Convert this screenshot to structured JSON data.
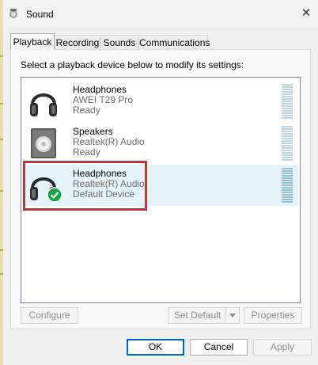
{
  "window": {
    "title": "Sound",
    "close_icon": "close-icon"
  },
  "tabs": [
    {
      "label": "Playback",
      "active": true
    },
    {
      "label": "Recording",
      "active": false
    },
    {
      "label": "Sounds",
      "active": false
    },
    {
      "label": "Communications",
      "active": false
    }
  ],
  "playback": {
    "instruction": "Select a playback device below to modify its settings:",
    "devices": [
      {
        "name": "Headphones",
        "description": "AWEI T29 Pro",
        "status": "Ready",
        "icon": "headphones-icon",
        "selected": false
      },
      {
        "name": "Speakers",
        "description": "Realtek(R) Audio",
        "status": "Ready",
        "icon": "speaker-icon",
        "selected": false
      },
      {
        "name": "Headphones",
        "description": "Realtek(R) Audio",
        "status": "Default Device",
        "icon": "headphones-icon",
        "selected": true,
        "default_badge_icon": "green-check-icon"
      }
    ],
    "buttons": {
      "configure": "Configure",
      "set_default": "Set Default",
      "properties": "Properties"
    }
  },
  "footer": {
    "ok": "OK",
    "cancel": "Cancel",
    "apply": "Apply"
  },
  "colors": {
    "highlight_box": "#d52b32",
    "selection": "#e5f3fb",
    "ok_border": "#0067c0",
    "check_badge": "#16a34a"
  }
}
